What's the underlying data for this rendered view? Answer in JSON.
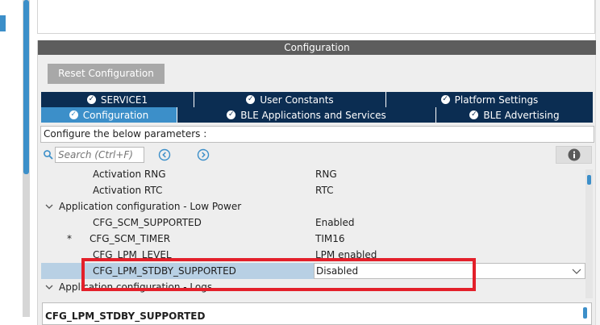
{
  "panel": {
    "header_title": "Configuration",
    "reset_label": "Reset Configuration"
  },
  "tabs": {
    "row1": [
      {
        "label": "SERVICE1",
        "active": false
      },
      {
        "label": "User Constants",
        "active": false
      },
      {
        "label": "Platform Settings",
        "active": false
      }
    ],
    "row2": [
      {
        "label": "Configuration",
        "active": true
      },
      {
        "label": "BLE Applications and Services",
        "active": false
      },
      {
        "label": "BLE Advertising",
        "active": false
      }
    ]
  },
  "configure_text": "Configure the below parameters :",
  "search": {
    "placeholder": "Search (Ctrl+F)"
  },
  "tree": {
    "rows": [
      {
        "type": "param",
        "name": "Activation RNG",
        "value": "RNG"
      },
      {
        "type": "param",
        "name": "Activation RTC",
        "value": "RTC"
      },
      {
        "type": "group",
        "name": "Application configuration - Low Power"
      },
      {
        "type": "param",
        "name": "CFG_SCM_SUPPORTED",
        "value": "Enabled"
      },
      {
        "type": "param",
        "name": "CFG_SCM_TIMER",
        "value": "TIM16",
        "star": "*"
      },
      {
        "type": "param",
        "name": "CFG_LPM_LEVEL",
        "value": "LPM enabled"
      },
      {
        "type": "param",
        "name": "CFG_LPM_STDBY_SUPPORTED",
        "value": "Disabled",
        "selected": true
      },
      {
        "type": "group",
        "name": "Application configuration - Logs"
      }
    ]
  },
  "description": {
    "title": "CFG_LPM_STDBY_SUPPORTED"
  },
  "colors": {
    "accent": "#3c8fc9",
    "tab_dark": "#0b2d52",
    "header_gray": "#5d5d5d",
    "highlight_red": "#e3202a",
    "selected_row": "#b8d0e4"
  }
}
